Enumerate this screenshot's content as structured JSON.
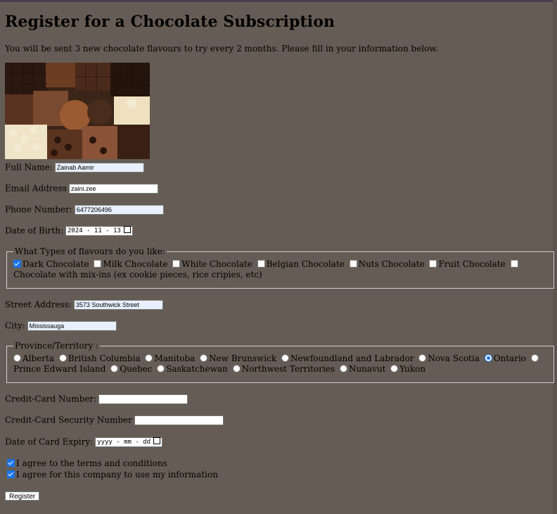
{
  "page": {
    "title": "Register for a Chocolate Subscription",
    "intro": "You will be sent 3 new chocolate flavours to try every 2 months. Please fill in your information below."
  },
  "fields": {
    "full_name": {
      "label": "Full Name:",
      "value": "Zainab Aamir"
    },
    "email": {
      "label": "Email Address",
      "value": "zaini.zee"
    },
    "phone": {
      "label": "Phone Number:",
      "value": "6477206496"
    },
    "dob": {
      "label": "Date of Birth:",
      "value": "2024 - 11 - 13"
    },
    "street": {
      "label": "Street Address:",
      "value": "3573 Southwick Street"
    },
    "city": {
      "label": "City:",
      "value": "Mississauga"
    },
    "cc_number": {
      "label": "Credit-Card Number:",
      "value": ""
    },
    "cc_security": {
      "label": "Credit-Card Security Number",
      "value": ""
    },
    "expiry": {
      "label": "Date of Card Expiry:",
      "value": "yyyy - mm - dd"
    }
  },
  "flavours": {
    "legend": "What Types of flavours do you like:",
    "options": [
      {
        "label": "Dark Chocolate",
        "checked": true
      },
      {
        "label": "Milk Chocolate",
        "checked": false
      },
      {
        "label": "White Chocolate",
        "checked": false
      },
      {
        "label": "Belgian Chocolate",
        "checked": false
      },
      {
        "label": "Nuts Chocolate",
        "checked": false
      },
      {
        "label": "Fruit Chocolate",
        "checked": false
      },
      {
        "label": "Chocolate with mix-ins (ex cookie pieces, rice cripies, etc)",
        "checked": false
      }
    ]
  },
  "province": {
    "legend": "Province/Territory :",
    "options": [
      {
        "label": "Alberta",
        "selected": false
      },
      {
        "label": "British Columbia",
        "selected": false
      },
      {
        "label": "Manitoba",
        "selected": false
      },
      {
        "label": "New Brunswick",
        "selected": false
      },
      {
        "label": "Newfoundland and Labrador",
        "selected": false
      },
      {
        "label": "Nova Scotia",
        "selected": false
      },
      {
        "label": "Ontario",
        "selected": true
      },
      {
        "label": "Prince Edward Island",
        "selected": false
      },
      {
        "label": "Quebec",
        "selected": false
      },
      {
        "label": "Saskatchewan",
        "selected": false
      },
      {
        "label": "Northwest Territories",
        "selected": false
      },
      {
        "label": "Nunavut",
        "selected": false
      },
      {
        "label": "Yukon",
        "selected": false
      }
    ]
  },
  "agreements": [
    {
      "label": "I agree to the terms and conditions",
      "checked": true
    },
    {
      "label": "I agree for this company to use my information",
      "checked": true
    }
  ],
  "submit_label": "Register",
  "colors": {
    "background": "#655d55",
    "accent": "#1a73e8",
    "autofill": "#e8f0fe"
  }
}
